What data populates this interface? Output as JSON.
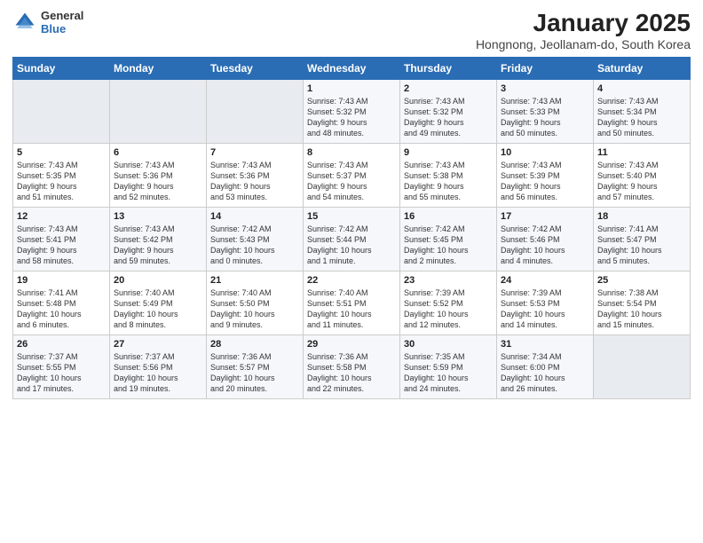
{
  "logo": {
    "general": "General",
    "blue": "Blue"
  },
  "header": {
    "title": "January 2025",
    "subtitle": "Hongnong, Jeollanam-do, South Korea"
  },
  "weekdays": [
    "Sunday",
    "Monday",
    "Tuesday",
    "Wednesday",
    "Thursday",
    "Friday",
    "Saturday"
  ],
  "weeks": [
    [
      {
        "day": "",
        "info": ""
      },
      {
        "day": "",
        "info": ""
      },
      {
        "day": "",
        "info": ""
      },
      {
        "day": "1",
        "info": "Sunrise: 7:43 AM\nSunset: 5:32 PM\nDaylight: 9 hours\nand 48 minutes."
      },
      {
        "day": "2",
        "info": "Sunrise: 7:43 AM\nSunset: 5:32 PM\nDaylight: 9 hours\nand 49 minutes."
      },
      {
        "day": "3",
        "info": "Sunrise: 7:43 AM\nSunset: 5:33 PM\nDaylight: 9 hours\nand 50 minutes."
      },
      {
        "day": "4",
        "info": "Sunrise: 7:43 AM\nSunset: 5:34 PM\nDaylight: 9 hours\nand 50 minutes."
      }
    ],
    [
      {
        "day": "5",
        "info": "Sunrise: 7:43 AM\nSunset: 5:35 PM\nDaylight: 9 hours\nand 51 minutes."
      },
      {
        "day": "6",
        "info": "Sunrise: 7:43 AM\nSunset: 5:36 PM\nDaylight: 9 hours\nand 52 minutes."
      },
      {
        "day": "7",
        "info": "Sunrise: 7:43 AM\nSunset: 5:36 PM\nDaylight: 9 hours\nand 53 minutes."
      },
      {
        "day": "8",
        "info": "Sunrise: 7:43 AM\nSunset: 5:37 PM\nDaylight: 9 hours\nand 54 minutes."
      },
      {
        "day": "9",
        "info": "Sunrise: 7:43 AM\nSunset: 5:38 PM\nDaylight: 9 hours\nand 55 minutes."
      },
      {
        "day": "10",
        "info": "Sunrise: 7:43 AM\nSunset: 5:39 PM\nDaylight: 9 hours\nand 56 minutes."
      },
      {
        "day": "11",
        "info": "Sunrise: 7:43 AM\nSunset: 5:40 PM\nDaylight: 9 hours\nand 57 minutes."
      }
    ],
    [
      {
        "day": "12",
        "info": "Sunrise: 7:43 AM\nSunset: 5:41 PM\nDaylight: 9 hours\nand 58 minutes."
      },
      {
        "day": "13",
        "info": "Sunrise: 7:43 AM\nSunset: 5:42 PM\nDaylight: 9 hours\nand 59 minutes."
      },
      {
        "day": "14",
        "info": "Sunrise: 7:42 AM\nSunset: 5:43 PM\nDaylight: 10 hours\nand 0 minutes."
      },
      {
        "day": "15",
        "info": "Sunrise: 7:42 AM\nSunset: 5:44 PM\nDaylight: 10 hours\nand 1 minute."
      },
      {
        "day": "16",
        "info": "Sunrise: 7:42 AM\nSunset: 5:45 PM\nDaylight: 10 hours\nand 2 minutes."
      },
      {
        "day": "17",
        "info": "Sunrise: 7:42 AM\nSunset: 5:46 PM\nDaylight: 10 hours\nand 4 minutes."
      },
      {
        "day": "18",
        "info": "Sunrise: 7:41 AM\nSunset: 5:47 PM\nDaylight: 10 hours\nand 5 minutes."
      }
    ],
    [
      {
        "day": "19",
        "info": "Sunrise: 7:41 AM\nSunset: 5:48 PM\nDaylight: 10 hours\nand 6 minutes."
      },
      {
        "day": "20",
        "info": "Sunrise: 7:40 AM\nSunset: 5:49 PM\nDaylight: 10 hours\nand 8 minutes."
      },
      {
        "day": "21",
        "info": "Sunrise: 7:40 AM\nSunset: 5:50 PM\nDaylight: 10 hours\nand 9 minutes."
      },
      {
        "day": "22",
        "info": "Sunrise: 7:40 AM\nSunset: 5:51 PM\nDaylight: 10 hours\nand 11 minutes."
      },
      {
        "day": "23",
        "info": "Sunrise: 7:39 AM\nSunset: 5:52 PM\nDaylight: 10 hours\nand 12 minutes."
      },
      {
        "day": "24",
        "info": "Sunrise: 7:39 AM\nSunset: 5:53 PM\nDaylight: 10 hours\nand 14 minutes."
      },
      {
        "day": "25",
        "info": "Sunrise: 7:38 AM\nSunset: 5:54 PM\nDaylight: 10 hours\nand 15 minutes."
      }
    ],
    [
      {
        "day": "26",
        "info": "Sunrise: 7:37 AM\nSunset: 5:55 PM\nDaylight: 10 hours\nand 17 minutes."
      },
      {
        "day": "27",
        "info": "Sunrise: 7:37 AM\nSunset: 5:56 PM\nDaylight: 10 hours\nand 19 minutes."
      },
      {
        "day": "28",
        "info": "Sunrise: 7:36 AM\nSunset: 5:57 PM\nDaylight: 10 hours\nand 20 minutes."
      },
      {
        "day": "29",
        "info": "Sunrise: 7:36 AM\nSunset: 5:58 PM\nDaylight: 10 hours\nand 22 minutes."
      },
      {
        "day": "30",
        "info": "Sunrise: 7:35 AM\nSunset: 5:59 PM\nDaylight: 10 hours\nand 24 minutes."
      },
      {
        "day": "31",
        "info": "Sunrise: 7:34 AM\nSunset: 6:00 PM\nDaylight: 10 hours\nand 26 minutes."
      },
      {
        "day": "",
        "info": ""
      }
    ]
  ]
}
